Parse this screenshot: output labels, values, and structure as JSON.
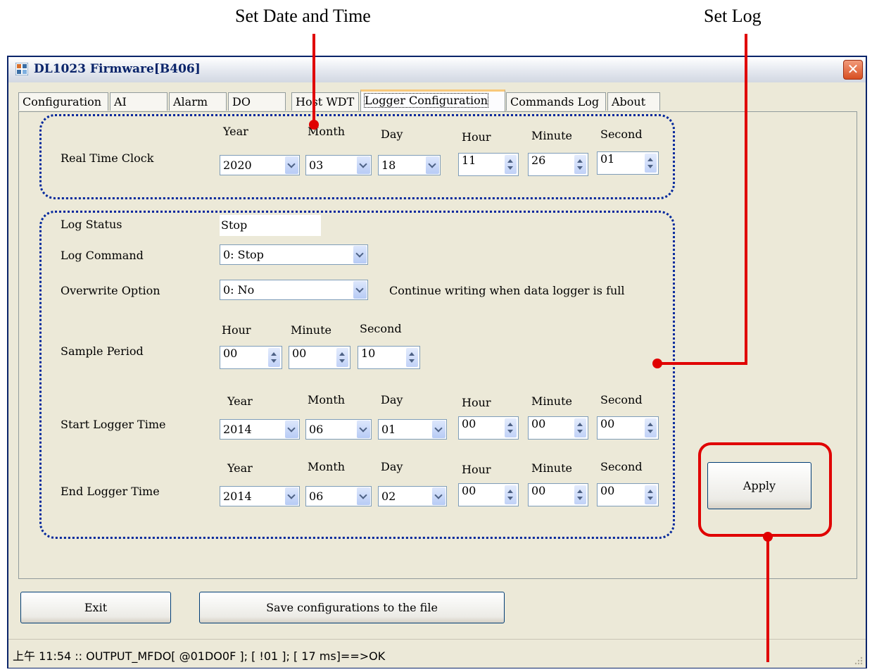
{
  "callouts": {
    "set_datetime": "Set Date and Time",
    "set_log": "Set Log"
  },
  "window": {
    "title": "DL1023 Firmware[B406]",
    "close_glyph": "✕"
  },
  "tabs": [
    "Configuration",
    "AI",
    "Alarm",
    "DO",
    "Host WDT",
    "Logger Configuration",
    "Commands Log",
    "About"
  ],
  "rtc": {
    "label": "Real Time Clock",
    "headers": {
      "year": "Year",
      "month": "Month",
      "day": "Day",
      "hour": "Hour",
      "minute": "Minute",
      "second": "Second"
    },
    "year": "2020",
    "month": "03",
    "day": "18",
    "hour": "11",
    "minute": "26",
    "second": "01"
  },
  "log": {
    "status_label": "Log Status",
    "status_value": "Stop",
    "command_label": "Log Command",
    "command_value": "0: Stop",
    "overwrite_label": "Overwrite Option",
    "overwrite_value": "0: No",
    "overwrite_note": "Continue writing when data logger is full",
    "sample_label": "Sample Period",
    "sample_headers": {
      "hour": "Hour",
      "minute": "Minute",
      "second": "Second"
    },
    "sample": {
      "hour": "00",
      "minute": "00",
      "second": "10"
    },
    "start_label": "Start Logger Time",
    "start": {
      "year": "2014",
      "month": "06",
      "day": "01",
      "hour": "00",
      "minute": "00",
      "second": "00"
    },
    "end_label": "End Logger Time",
    "end": {
      "year": "2014",
      "month": "06",
      "day": "02",
      "hour": "00",
      "minute": "00",
      "second": "00"
    },
    "headers": {
      "year": "Year",
      "month": "Month",
      "day": "Day",
      "hour": "Hour",
      "minute": "Minute",
      "second": "Second"
    }
  },
  "buttons": {
    "apply": "Apply",
    "exit": "Exit",
    "save": "Save configurations to the file"
  },
  "status_bar": "上午 11:54 :: OUTPUT_MFDO[ @01DO0F ]; [ !01 ]; [ 17 ms]==>OK",
  "colors": {
    "callout_red": "#e00000",
    "dotted_blue": "#00279c"
  }
}
